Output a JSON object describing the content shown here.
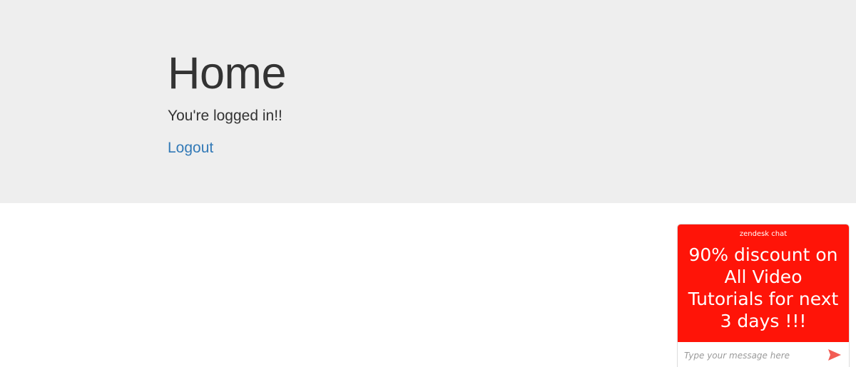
{
  "page": {
    "title": "Home",
    "status": "You're logged in!!",
    "logout_label": "Logout",
    "link_color": "#337ab7",
    "header_bg": "#eeeeee"
  },
  "chat_widget": {
    "brand": "zendesk chat",
    "promo_message": "90% discount on All Video Tutorials for next 3 days !!!",
    "input_placeholder": "Type your message here",
    "send_icon": "send-arrow-icon",
    "accent_color": "#ff1408"
  }
}
